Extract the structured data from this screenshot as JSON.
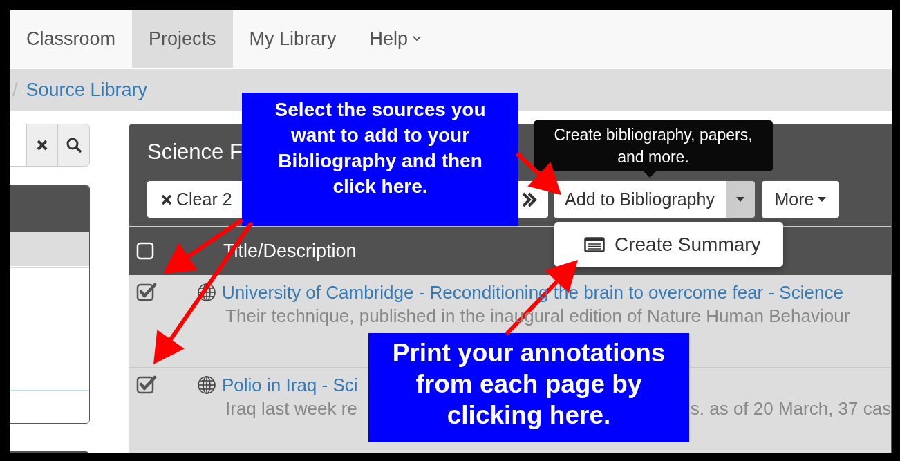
{
  "nav": {
    "tabs": [
      {
        "label": "Classroom",
        "selected": false,
        "dropdown": false
      },
      {
        "label": "Projects",
        "selected": true,
        "dropdown": false
      },
      {
        "label": "My Library",
        "selected": false,
        "dropdown": false
      },
      {
        "label": "Help",
        "selected": false,
        "dropdown": true
      }
    ]
  },
  "breadcrumb": {
    "separator": "/",
    "current": "Source Library"
  },
  "panel": {
    "title": "Science F",
    "toolbar": {
      "clear_label": "Clear 2",
      "add_label": "Add to Bibliography",
      "more_label": "More"
    },
    "tooltip": "Create bibliography, papers, and more.",
    "menu": [
      {
        "label": "Create Summary"
      }
    ],
    "select_all": {
      "checked": false
    },
    "column_header": "Title/Description",
    "rows": [
      {
        "checked": true,
        "title": "University of Cambridge - Reconditioning the brain to overcome fear - Science",
        "description_parts": [
          "Their technique, published in the inaugural edition of Nature Human Behaviour"
        ]
      },
      {
        "checked": true,
        "title": "Polio in Iraq - Sci",
        "description_parts": [
          "Iraq last week re",
          "s. as of 20 March, 37 cas"
        ]
      }
    ]
  },
  "callouts": [
    {
      "text": "Select the sources you want to add to your Bibliography and then click here."
    },
    {
      "text": "Print your annotations from each page by clicking here."
    }
  ]
}
